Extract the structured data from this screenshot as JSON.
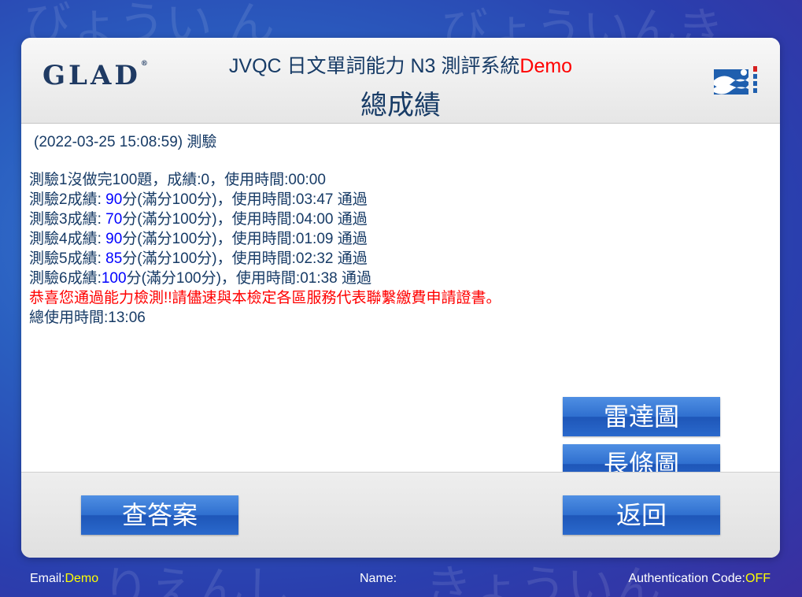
{
  "header": {
    "logo_text": "GLAD",
    "logo_reg": "®",
    "title_main": "JVQC 日文單詞能力 N3 測評系統",
    "title_demo": "Demo",
    "subtitle": "總成績"
  },
  "content": {
    "test_time": "(2022-03-25 15:08:59) 測驗",
    "result_lines": [
      {
        "label": "測驗1沒做完100題，成績:0，使用時間:00:00",
        "score": "",
        "suffix": ""
      },
      {
        "label": "測驗2成績: ",
        "score": "90",
        "suffix": "分(滿分100分)，使用時間:03:47 通過"
      },
      {
        "label": "測驗3成績: ",
        "score": "70",
        "suffix": "分(滿分100分)，使用時間:04:00 通過"
      },
      {
        "label": "測驗4成績: ",
        "score": "90",
        "suffix": "分(滿分100分)，使用時間:01:09 通過"
      },
      {
        "label": "測驗5成績: ",
        "score": "85",
        "suffix": "分(滿分100分)，使用時間:02:32 通過"
      },
      {
        "label": "測驗6成績:",
        "score": "100",
        "suffix": "分(滿分100分)，使用時間:01:38 通過"
      }
    ],
    "congrats": "恭喜您通過能力檢測!!請儘速與本檢定各區服務代表聯繫繳費申請證書。",
    "total_time": "總使用時間:13:06"
  },
  "buttons": {
    "radar": "雷達圖",
    "bar": "長條圖",
    "answers": "查答案",
    "back": "返回"
  },
  "status": {
    "email_label": "Email:",
    "email_value": "Demo",
    "name_label": "Name:",
    "auth_label": "Authentication Code:",
    "auth_value": "OFF"
  },
  "colors": {
    "accent_blue": "#2f6fcf",
    "demo_red": "#ff0000",
    "score_blue": "#0000ff",
    "status_yellow": "#ffff00",
    "text_navy": "#173b66"
  }
}
